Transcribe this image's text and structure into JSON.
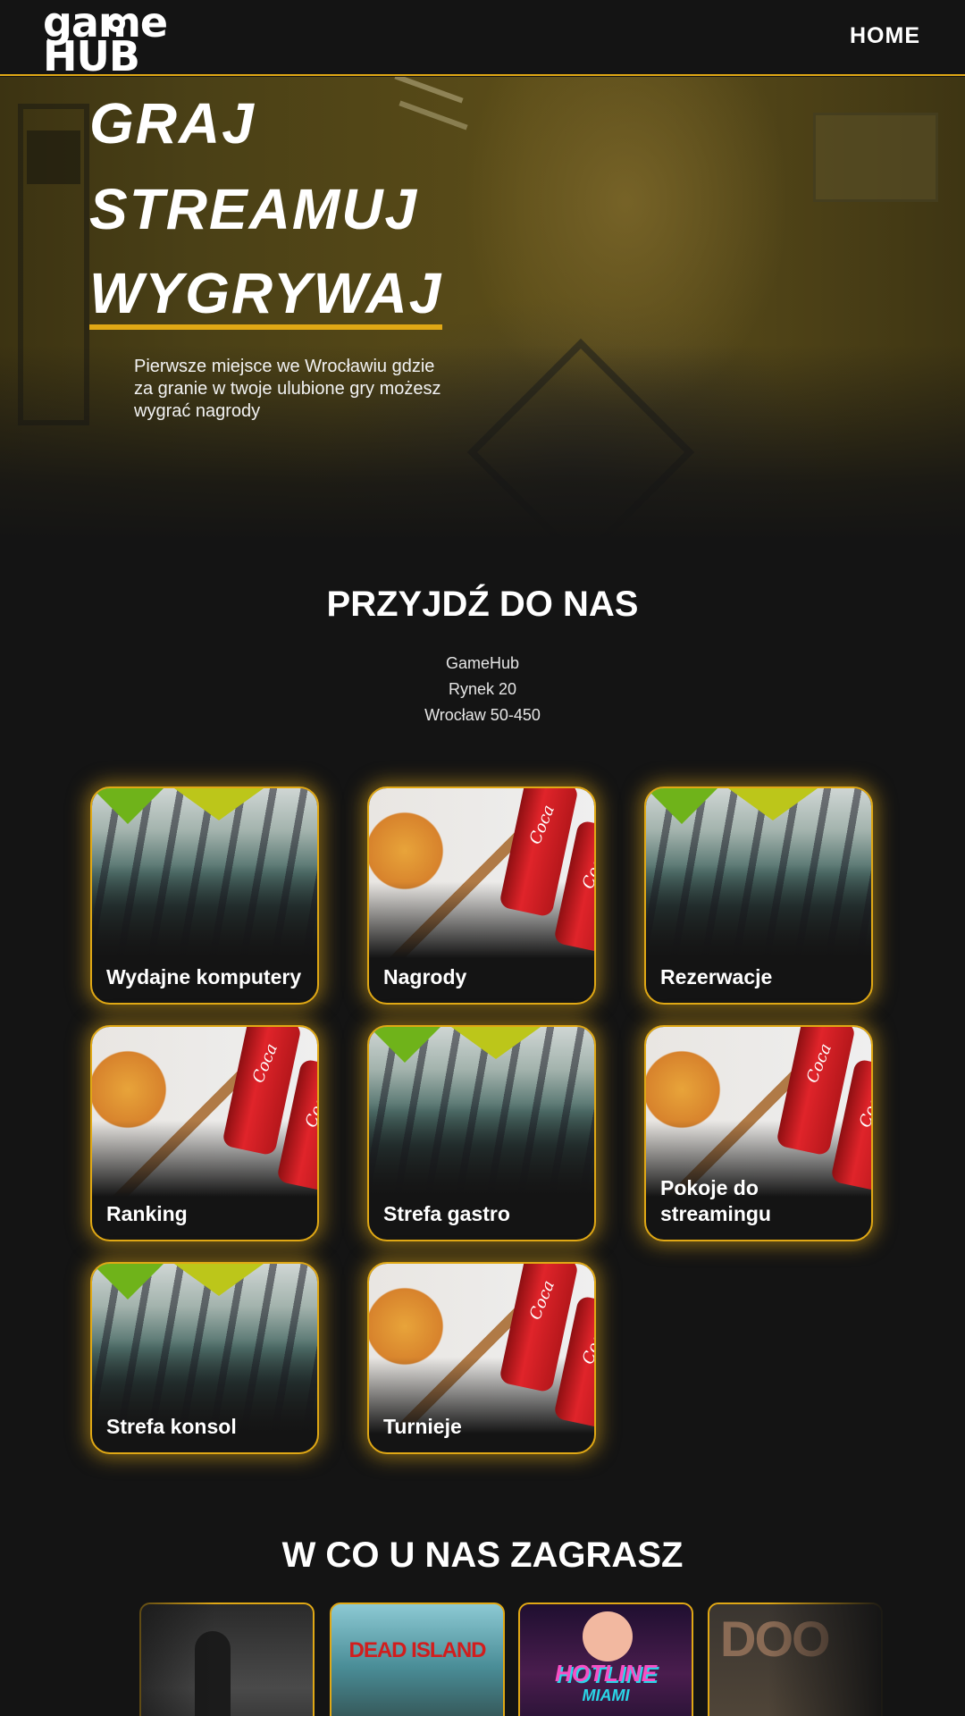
{
  "header": {
    "logo_line1": "game",
    "logo_line2": "HUB",
    "nav_home": "HOME"
  },
  "hero": {
    "line1": "GRAJ",
    "line2": "STREAMUJ",
    "line3": "WYGRYWAJ",
    "description": "Pierwsze miejsce we Wrocławiu gdzie za granie w twoje ulubione gry możesz wygrać nagrody"
  },
  "location": {
    "title": "PRZYJDŹ DO NAS",
    "name": "GameHub",
    "street": "Rynek 20",
    "city": "Wrocław 50-450"
  },
  "features": [
    {
      "label": "Wydajne komputery",
      "image": "pc-room"
    },
    {
      "label": "Nagrody",
      "image": "pizza-cola"
    },
    {
      "label": "Rezerwacje",
      "image": "pc-room"
    },
    {
      "label": "Ranking",
      "image": "pizza-cola"
    },
    {
      "label": "Strefa gastro",
      "image": "pc-room"
    },
    {
      "label": "Pokoje do streamingu",
      "image": "pizza-cola"
    },
    {
      "label": "Strefa konsol",
      "image": "pc-room"
    },
    {
      "label": "Turnieje",
      "image": "pizza-cola"
    }
  ],
  "games": {
    "title": "W CO U NAS ZAGRASZ",
    "items": [
      {
        "cover": "dishonored-cover"
      },
      {
        "cover": "dead-island-cover",
        "text": "DEAD ISLAND"
      },
      {
        "cover": "hotline-miami-cover",
        "text": "HOTLINE",
        "text2": "MIAMI"
      },
      {
        "cover": "doom-cover",
        "text": "DOO"
      }
    ]
  },
  "colors": {
    "accent": "#e0a815",
    "background": "#141414",
    "text": "#ffffff"
  }
}
